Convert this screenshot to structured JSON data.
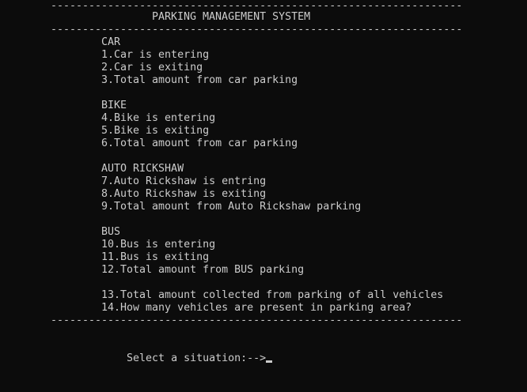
{
  "window": {
    "background": "#0c0c0c",
    "text_color": "#cccccc"
  },
  "divider": "-----------------------------------------------------------------",
  "title": "PARKING MANAGEMENT SYSTEM",
  "car": {
    "heading": "CAR",
    "opt1": "1.Car is entering",
    "opt2": "2.Car is exiting",
    "opt3": "3.Total amount from car parking"
  },
  "bike": {
    "heading": "BIKE",
    "opt4": "4.Bike is entering",
    "opt5": "5.Bike is exiting",
    "opt6": "6.Total amount from car parking"
  },
  "auto": {
    "heading": "AUTO RICKSHAW",
    "opt7": "7.Auto Rickshaw is entring",
    "opt8": "8.Auto Rickshaw is exiting",
    "opt9": "9.Total amount from Auto Rickshaw parking"
  },
  "bus": {
    "heading": "BUS",
    "opt10": "10.Bus is entering",
    "opt11": "11.Bus is exiting",
    "opt12": "12.Total amount from BUS parking"
  },
  "summary": {
    "opt13": "13.Total amount collected from parking of all vehicles",
    "opt14": "14.How many vehicles are present in parking area?"
  },
  "prompt": "Select a situation:-->"
}
